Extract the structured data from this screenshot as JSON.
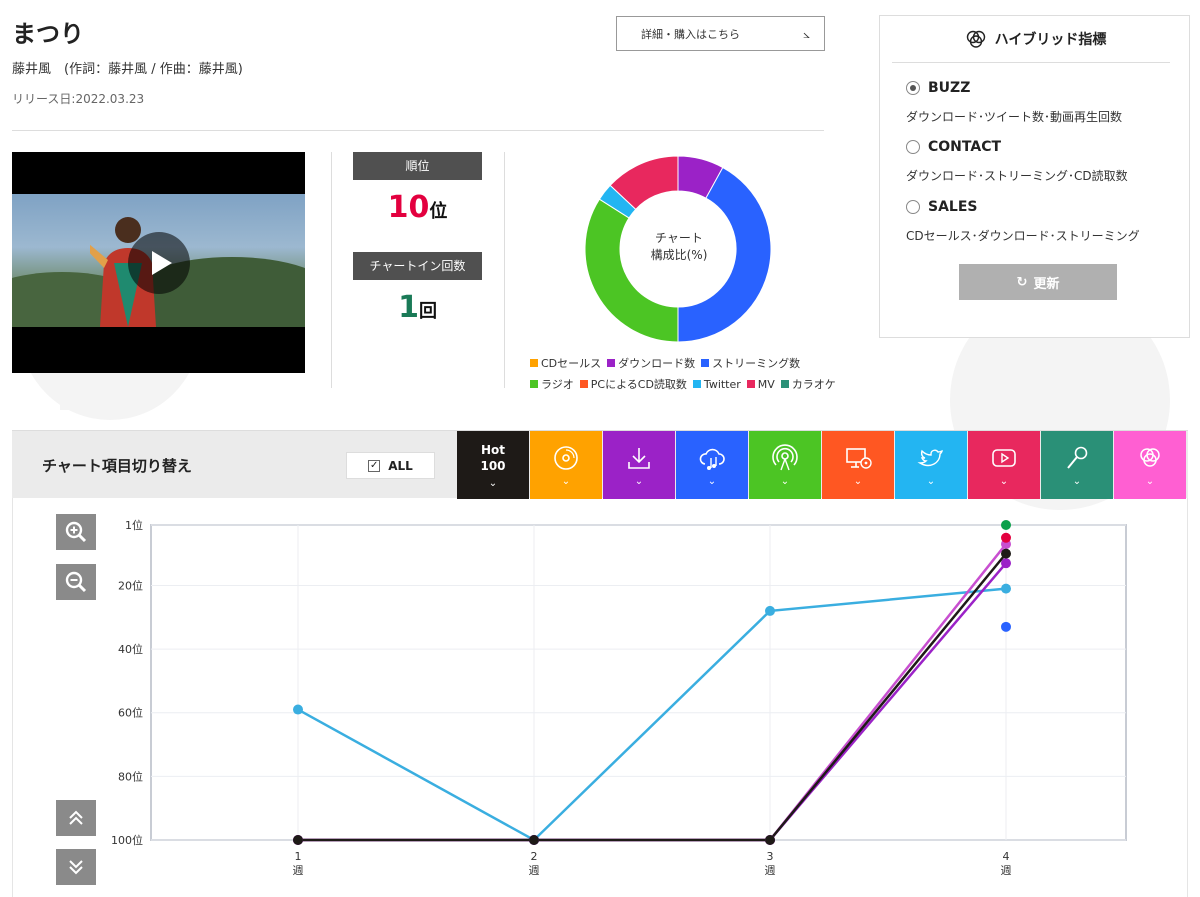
{
  "song": {
    "title": "まつり",
    "credit": "藤井風　(作詞：藤井風 / 作曲：藤井風)",
    "release": "リリース日:2022.03.23",
    "detail_button": "詳細・購入はこちら"
  },
  "stats": {
    "rank_label": "順位",
    "rank_value": "10",
    "rank_unit": "位",
    "chartin_label": "チャートイン回数",
    "chartin_value": "1",
    "chartin_unit": "回"
  },
  "composition": {
    "center_line1": "チャート",
    "center_line2": "構成比(%)",
    "slices": [
      {
        "name": "ダウンロード数",
        "color": "#9b22c7",
        "value": 8
      },
      {
        "name": "ストリーミング数",
        "color": "#2962ff",
        "value": 42
      },
      {
        "name": "ラジオ",
        "color": "#4cc524",
        "value": 34
      },
      {
        "name": "Twitter",
        "color": "#23b5f2",
        "value": 3
      },
      {
        "name": "MV",
        "color": "#e8285e",
        "value": 13
      }
    ],
    "legend_row1": [
      {
        "name": "CDセールス",
        "color": "#ffa200"
      },
      {
        "name": "ダウンロード数",
        "color": "#9b22c7"
      },
      {
        "name": "ストリーミング数",
        "color": "#2962ff"
      }
    ],
    "legend_row2": [
      {
        "name": "ラジオ",
        "color": "#4cc524"
      },
      {
        "name": "PCによるCD読取数",
        "color": "#ff5722"
      },
      {
        "name": "Twitter",
        "color": "#23b5f2"
      },
      {
        "name": "MV",
        "color": "#e8285e"
      },
      {
        "name": "カラオケ",
        "color": "#2a9077"
      }
    ]
  },
  "hybrid": {
    "title": "ハイブリッド指標",
    "options": [
      {
        "name": "BUZZ",
        "desc": "ダウンロード･ツイート数･動画再生回数",
        "selected": true
      },
      {
        "name": "CONTACT",
        "desc": "ダウンロード･ストリーミング･CD読取数",
        "selected": false
      },
      {
        "name": "SALES",
        "desc": "CDセールス･ダウンロード･ストリーミング",
        "selected": false
      }
    ],
    "update_label": "更新"
  },
  "toolbar": {
    "title": "チャート項目切り替え",
    "all_label": "ALL",
    "hot_line1": "Hot",
    "hot_line2": "100",
    "tabs": [
      {
        "icon": "hot100-icon",
        "color": "#1e1a17"
      },
      {
        "icon": "cd-icon",
        "color": "#ffa200"
      },
      {
        "icon": "download-icon",
        "color": "#9b22c7"
      },
      {
        "icon": "streaming-cloud-icon",
        "color": "#2962ff"
      },
      {
        "icon": "radio-icon",
        "color": "#4cc524"
      },
      {
        "icon": "pc-cd-icon",
        "color": "#ff5722"
      },
      {
        "icon": "twitter-icon",
        "color": "#23b5f2"
      },
      {
        "icon": "youtube-icon",
        "color": "#e8285e"
      },
      {
        "icon": "karaoke-mic-icon",
        "color": "#2a9077"
      },
      {
        "icon": "hybrid-icon",
        "color": "#ff5fd2"
      }
    ]
  },
  "chart_data": {
    "type": "line",
    "x": [
      1,
      2,
      3,
      4
    ],
    "xtick_labels": [
      "1",
      "2",
      "3",
      "4"
    ],
    "xtick_sub": "週",
    "ytick_labels": [
      "1位",
      "20位",
      "40位",
      "60位",
      "80位",
      "100位"
    ],
    "yticks": [
      1,
      20,
      40,
      60,
      80,
      100
    ],
    "ylim": [
      1,
      100
    ],
    "y_inverted": true,
    "grid": true,
    "series": [
      {
        "color": "#3aaee0",
        "values": [
          59,
          100,
          28,
          21
        ]
      },
      {
        "color": "#c84fd0",
        "values": [
          100,
          100,
          100,
          7
        ]
      },
      {
        "color": "#9b22c7",
        "values": [
          100,
          100,
          100,
          13
        ]
      },
      {
        "color": "#1e1a17",
        "values": [
          100,
          100,
          100,
          10
        ]
      },
      {
        "color": "#e3003f",
        "values": [
          null,
          null,
          null,
          5
        ]
      },
      {
        "color": "#0ba04a",
        "values": [
          null,
          null,
          null,
          1
        ]
      },
      {
        "color": "#2962ff",
        "values": [
          null,
          null,
          null,
          33
        ]
      }
    ]
  }
}
